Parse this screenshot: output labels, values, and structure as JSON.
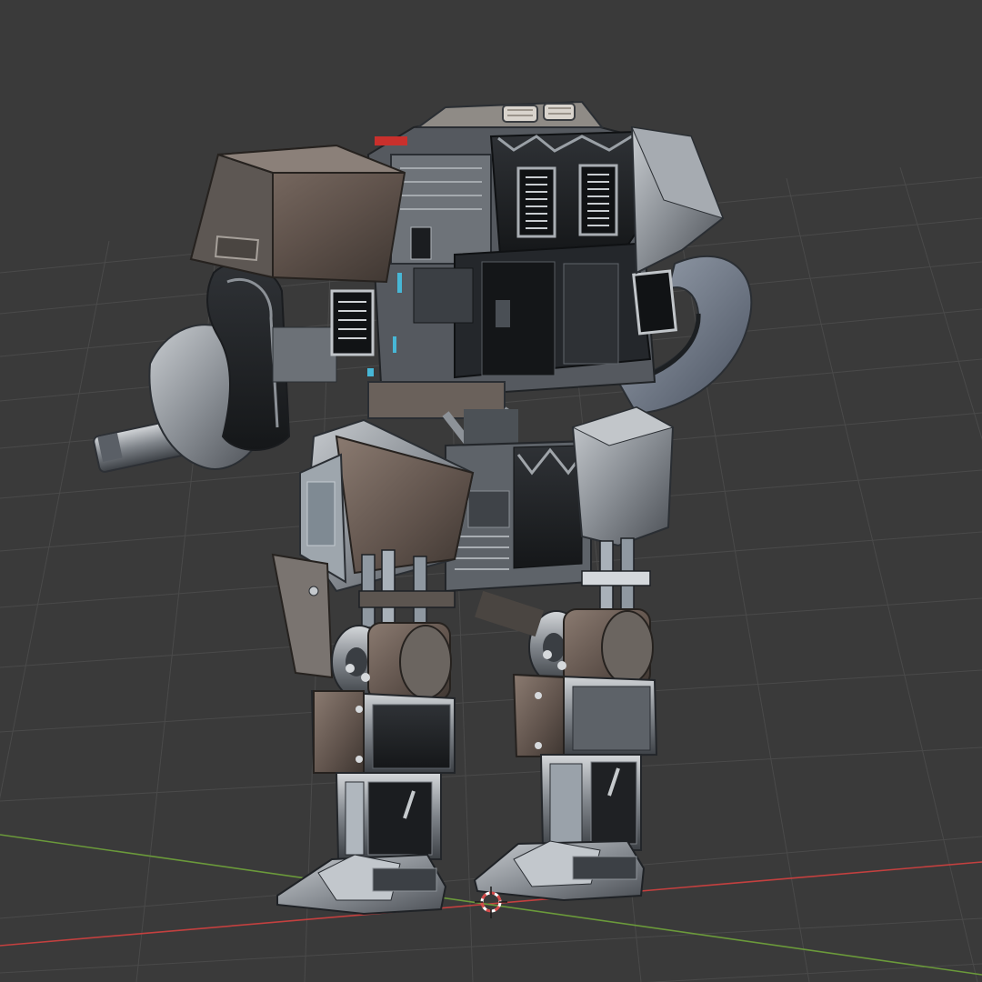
{
  "viewport": {
    "background_color": "#3a3a3a",
    "grid_color": "#4b4b4b",
    "x_axis_color": "#c4403f",
    "y_axis_color": "#6b9a3a",
    "cursor_color": "#d64c4c"
  },
  "model": {
    "steel_light": "#b9bcc0",
    "steel_mid": "#7d8187",
    "steel_dark": "#3f4348",
    "panel_black": "#1d1f22",
    "rust_brown": "#6a5a52",
    "accent_red": "#c9302c",
    "accent_cyan": "#47b7d6",
    "lamp_color": "#d9d4cd"
  },
  "icons": {
    "cursor": "3d-cursor-icon"
  }
}
